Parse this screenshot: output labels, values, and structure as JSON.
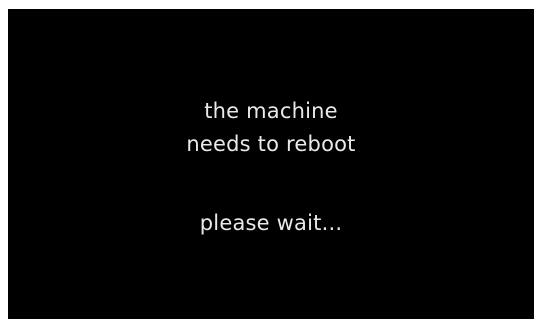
{
  "screen": {
    "background_color": "#000000",
    "text_color": "#e9e9e9",
    "message_lines": [
      "the machine",
      "needs to reboot"
    ],
    "status": "please wait..."
  }
}
